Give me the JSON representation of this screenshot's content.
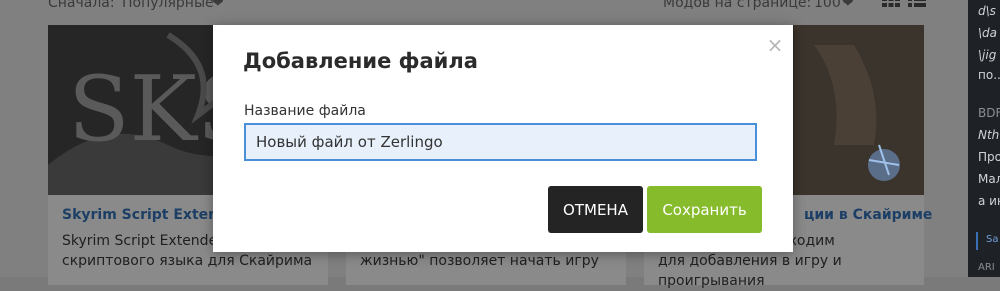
{
  "background": {
    "sort_label": "Сначала:",
    "sort_value": "Популярные",
    "per_page_label": "Модов на странице:",
    "per_page_value": "100",
    "cards": [
      {
        "title": "Skyrim Script Extender",
        "desc": "Skyrim Script Extender расширение скриптового языка для Скайрима"
      },
      {
        "title": "",
        "desc": "Модификация \"Живи другой жизнью\" позволяет начать игру"
      },
      {
        "title": "ции в Скайриме",
        "desc": "Данный мод необходим для добавления в игру и проигрывания"
      }
    ],
    "right_panel_lines": [
      "d\\s",
      "\\da",
      "\\jig",
      "по...",
      "BDF",
      "Nth",
      "Про",
      "Мал",
      "а ин",
      "Sa",
      "ARI"
    ]
  },
  "modal": {
    "title": "Добавление файла",
    "close_symbol": "×",
    "field_label": "Название файла",
    "field_value": "Новый файл от Zerlingo",
    "cancel_label": "ОТМЕНА",
    "save_label": "Сохранить"
  },
  "colors": {
    "accent_save": "#86bb2c",
    "cancel_bg": "#242424",
    "input_border": "#4a90d9"
  }
}
